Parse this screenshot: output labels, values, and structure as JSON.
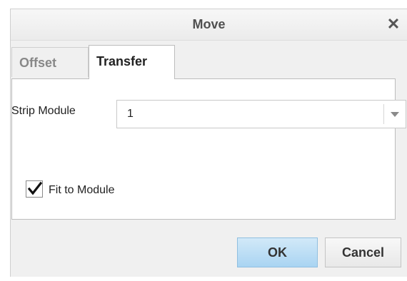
{
  "dialog": {
    "title": "Move",
    "close_icon": "close-icon"
  },
  "tabs": [
    {
      "label": "Offset",
      "active": false
    },
    {
      "label": "Transfer",
      "active": true
    }
  ],
  "form": {
    "strip_module": {
      "label": "Strip Module",
      "value": "1"
    },
    "fit_to_module": {
      "label": "Fit to Module",
      "checked": true
    }
  },
  "buttons": {
    "ok": "OK",
    "cancel": "Cancel"
  },
  "colors": {
    "ok_button": "#b7dbf5",
    "dialog_background": "#f0f0f0",
    "panel_background": "#ffffff"
  }
}
